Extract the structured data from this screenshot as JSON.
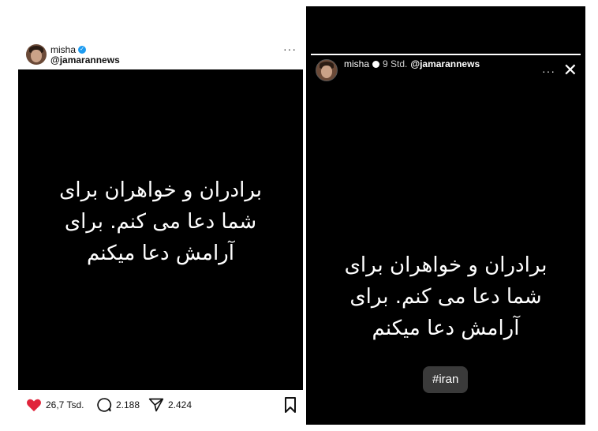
{
  "post": {
    "username": "misha",
    "handle": "@jamarannews",
    "menu_icon": "more-dots-icon",
    "text": "برادران و خواهران برای\nشما دعا می کنم. برای\nآرامش دعا میکنم",
    "actions": {
      "likes": "26,7 Tsd.",
      "comments": "2.188",
      "shares": "2.424"
    },
    "colors": {
      "like": "#e0243a",
      "verified": "#1d9bf0"
    }
  },
  "story": {
    "username": "misha",
    "time": "9 Std.",
    "mention": "@jamarannews",
    "progress": 1.0,
    "text": "برادران و خواهران برای\nشما دعا می کنم. برای\nآرامش دعا میکنم",
    "hashtag": "#iran",
    "more_label": "···",
    "close_label": "✕"
  }
}
